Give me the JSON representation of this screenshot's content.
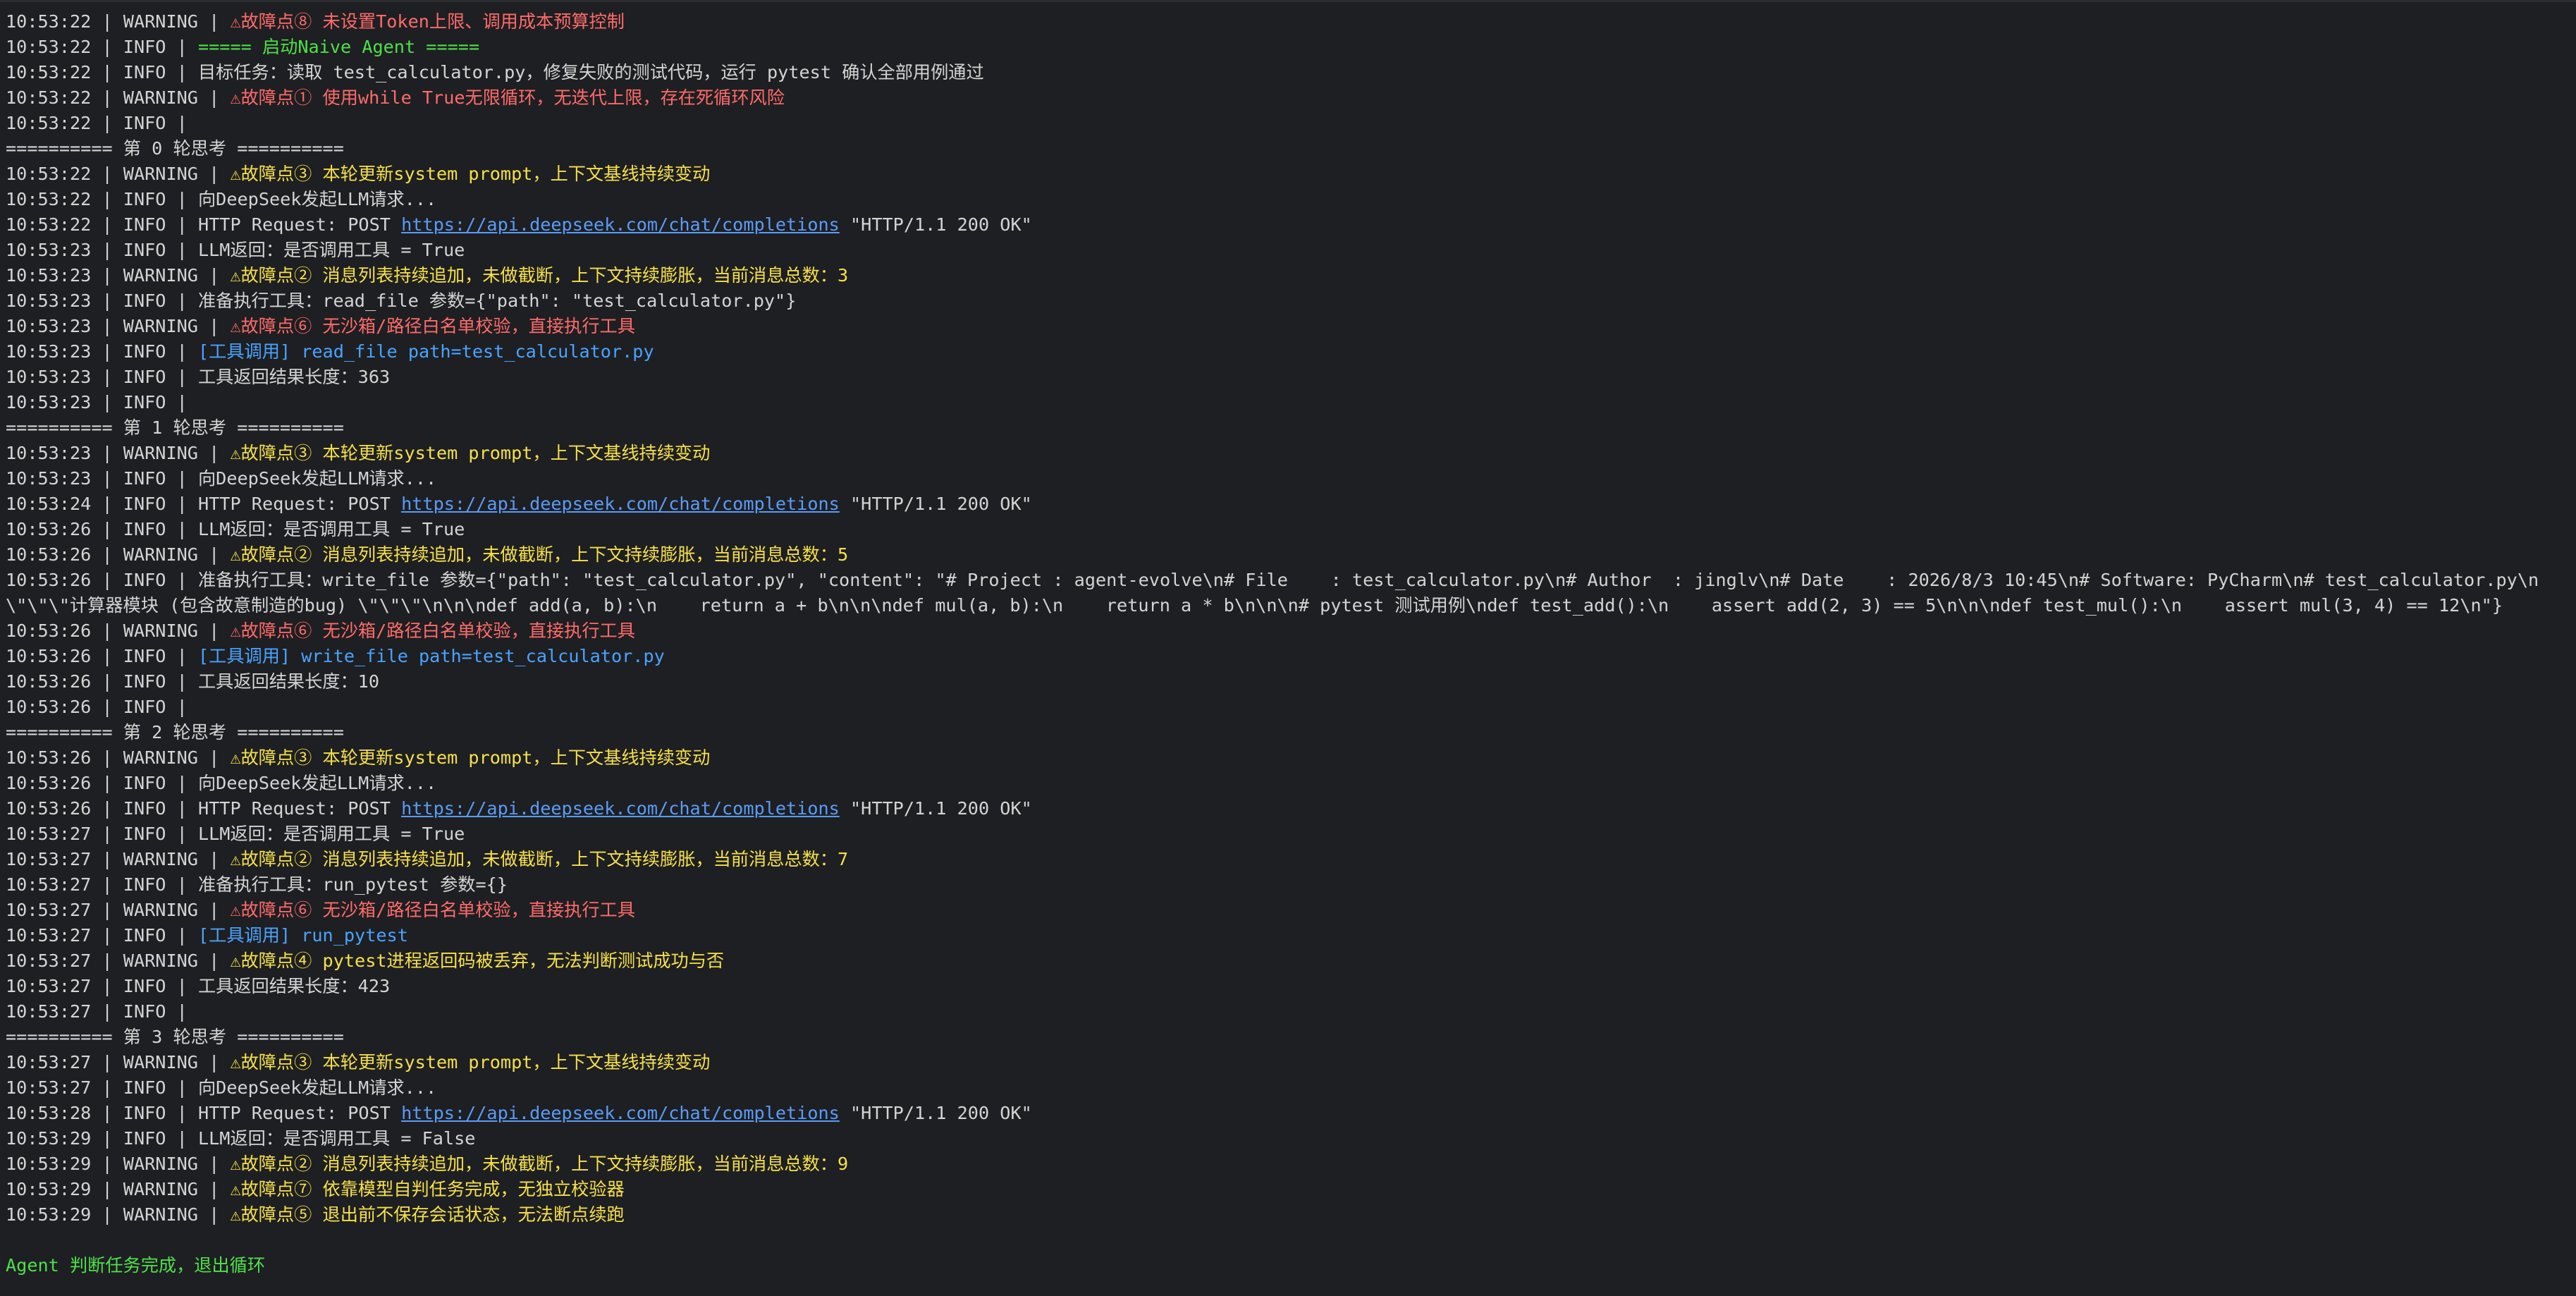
{
  "colors": {
    "background": "#1e1f22",
    "text": "#d4d4d4",
    "warning_yellow": "#f5e04a",
    "warning_red": "#ff6b6b",
    "tool_blue": "#4aa3ff",
    "success_green": "#4ee04a",
    "link": "#5a9cf8"
  },
  "lines": [
    {
      "pre": "10:53:22 | WARNING | ",
      "msg": "⚠故障点⑧ 未设置Token上限、调用成本预算控制",
      "style": "err"
    },
    {
      "pre": "10:53:22 | INFO | ",
      "msg": "===== 启动Naive Agent =====",
      "style": "green"
    },
    {
      "pre": "10:53:22 | INFO | ",
      "msg": "目标任务：读取 test_calculator.py，修复失败的测试代码，运行 pytest 确认全部用例通过",
      "style": ""
    },
    {
      "pre": "10:53:22 | WARNING | ",
      "msg": "⚠故障点① 使用while True无限循环，无迭代上限，存在死循环风险",
      "style": "err"
    },
    {
      "pre": "10:53:22 | INFO | ",
      "msg": "",
      "style": ""
    },
    {
      "pre": "",
      "msg": "========== 第 0 轮思考 ==========",
      "style": ""
    },
    {
      "pre": "10:53:22 | WARNING | ",
      "msg": "⚠故障点③ 本轮更新system prompt，上下文基线持续变动",
      "style": "warn"
    },
    {
      "pre": "10:53:22 | INFO | ",
      "msg": "向DeepSeek发起LLM请求...",
      "style": ""
    },
    {
      "pre": "10:53:22 | INFO | ",
      "msg": "HTTP Request: POST ",
      "url": "https://api.deepseek.com/chat/completions",
      "post": " \"HTTP/1.1 200 OK\"",
      "style": ""
    },
    {
      "pre": "10:53:23 | INFO | ",
      "msg": "LLM返回：是否调用工具 = True",
      "style": ""
    },
    {
      "pre": "10:53:23 | WARNING | ",
      "msg": "⚠故障点② 消息列表持续追加，未做截断，上下文持续膨胀，当前消息总数：3",
      "style": "warn"
    },
    {
      "pre": "10:53:23 | INFO | ",
      "msg": "准备执行工具：read_file 参数={\"path\": \"test_calculator.py\"}",
      "style": ""
    },
    {
      "pre": "10:53:23 | WARNING | ",
      "msg": "⚠故障点⑥ 无沙箱/路径白名单校验，直接执行工具",
      "style": "err"
    },
    {
      "pre": "10:53:23 | INFO | ",
      "msg": "[工具调用] read_file path=test_calculator.py",
      "style": "tool"
    },
    {
      "pre": "10:53:23 | INFO | ",
      "msg": "工具返回结果长度：363",
      "style": ""
    },
    {
      "pre": "10:53:23 | INFO | ",
      "msg": "",
      "style": ""
    },
    {
      "pre": "",
      "msg": "========== 第 1 轮思考 ==========",
      "style": ""
    },
    {
      "pre": "10:53:23 | WARNING | ",
      "msg": "⚠故障点③ 本轮更新system prompt，上下文基线持续变动",
      "style": "warn"
    },
    {
      "pre": "10:53:23 | INFO | ",
      "msg": "向DeepSeek发起LLM请求...",
      "style": ""
    },
    {
      "pre": "10:53:24 | INFO | ",
      "msg": "HTTP Request: POST ",
      "url": "https://api.deepseek.com/chat/completions",
      "post": " \"HTTP/1.1 200 OK\"",
      "style": ""
    },
    {
      "pre": "10:53:26 | INFO | ",
      "msg": "LLM返回：是否调用工具 = True",
      "style": ""
    },
    {
      "pre": "10:53:26 | WARNING | ",
      "msg": "⚠故障点② 消息列表持续追加，未做截断，上下文持续膨胀，当前消息总数：5",
      "style": "warn"
    },
    {
      "pre": "10:53:26 | INFO | ",
      "msg": "准备执行工具：write_file 参数={\"path\": \"test_calculator.py\", \"content\": \"# Project : agent-evolve\\n# File    : test_calculator.py\\n# Author  : jinglv\\n# Date    : 2026/8/3 10:45\\n# Software: PyCharm\\n# test_calculator.py\\n\\\"\\\"\\\"计算器模块 (包含故意制造的bug) \\\"\\\"\\\"\\n\\n\\ndef add(a, b):\\n    return a + b\\n\\n\\ndef mul(a, b):\\n    return a * b\\n\\n\\n# pytest 测试用例\\ndef test_add():\\n    assert add(2, 3) == 5\\n\\n\\ndef test_mul():\\n    assert mul(3, 4) == 12\\n\"}",
      "style": "",
      "wrap": true
    },
    {
      "pre": "10:53:26 | WARNING | ",
      "msg": "⚠故障点⑥ 无沙箱/路径白名单校验，直接执行工具",
      "style": "err"
    },
    {
      "pre": "10:53:26 | INFO | ",
      "msg": "[工具调用] write_file path=test_calculator.py",
      "style": "tool"
    },
    {
      "pre": "10:53:26 | INFO | ",
      "msg": "工具返回结果长度：10",
      "style": ""
    },
    {
      "pre": "10:53:26 | INFO | ",
      "msg": "",
      "style": ""
    },
    {
      "pre": "",
      "msg": "========== 第 2 轮思考 ==========",
      "style": ""
    },
    {
      "pre": "10:53:26 | WARNING | ",
      "msg": "⚠故障点③ 本轮更新system prompt，上下文基线持续变动",
      "style": "warn"
    },
    {
      "pre": "10:53:26 | INFO | ",
      "msg": "向DeepSeek发起LLM请求...",
      "style": ""
    },
    {
      "pre": "10:53:26 | INFO | ",
      "msg": "HTTP Request: POST ",
      "url": "https://api.deepseek.com/chat/completions",
      "post": " \"HTTP/1.1 200 OK\"",
      "style": ""
    },
    {
      "pre": "10:53:27 | INFO | ",
      "msg": "LLM返回：是否调用工具 = True",
      "style": ""
    },
    {
      "pre": "10:53:27 | WARNING | ",
      "msg": "⚠故障点② 消息列表持续追加，未做截断，上下文持续膨胀，当前消息总数：7",
      "style": "warn"
    },
    {
      "pre": "10:53:27 | INFO | ",
      "msg": "准备执行工具：run_pytest 参数={}",
      "style": ""
    },
    {
      "pre": "10:53:27 | WARNING | ",
      "msg": "⚠故障点⑥ 无沙箱/路径白名单校验，直接执行工具",
      "style": "err"
    },
    {
      "pre": "10:53:27 | INFO | ",
      "msg": "[工具调用] run_pytest",
      "style": "tool"
    },
    {
      "pre": "10:53:27 | WARNING | ",
      "msg": "⚠故障点④ pytest进程返回码被丢弃，无法判断测试成功与否",
      "style": "warn"
    },
    {
      "pre": "10:53:27 | INFO | ",
      "msg": "工具返回结果长度：423",
      "style": ""
    },
    {
      "pre": "10:53:27 | INFO | ",
      "msg": "",
      "style": ""
    },
    {
      "pre": "",
      "msg": "========== 第 3 轮思考 ==========",
      "style": ""
    },
    {
      "pre": "10:53:27 | WARNING | ",
      "msg": "⚠故障点③ 本轮更新system prompt，上下文基线持续变动",
      "style": "warn"
    },
    {
      "pre": "10:53:27 | INFO | ",
      "msg": "向DeepSeek发起LLM请求...",
      "style": ""
    },
    {
      "pre": "10:53:28 | INFO | ",
      "msg": "HTTP Request: POST ",
      "url": "https://api.deepseek.com/chat/completions",
      "post": " \"HTTP/1.1 200 OK\"",
      "style": ""
    },
    {
      "pre": "10:53:29 | INFO | ",
      "msg": "LLM返回：是否调用工具 = False",
      "style": ""
    },
    {
      "pre": "10:53:29 | WARNING | ",
      "msg": "⚠故障点② 消息列表持续追加，未做截断，上下文持续膨胀，当前消息总数：9",
      "style": "warn"
    },
    {
      "pre": "10:53:29 | WARNING | ",
      "msg": "⚠故障点⑦ 依靠模型自判任务完成，无独立校验器",
      "style": "warn"
    },
    {
      "pre": "10:53:29 | WARNING | ",
      "msg": "⚠故障点⑤ 退出前不保存会话状态，无法断点续跑",
      "style": "warn"
    },
    {
      "pre": "",
      "msg": "",
      "style": "",
      "blank": true
    },
    {
      "pre": "",
      "msg": "Agent 判断任务完成，退出循环",
      "style": "green"
    }
  ]
}
